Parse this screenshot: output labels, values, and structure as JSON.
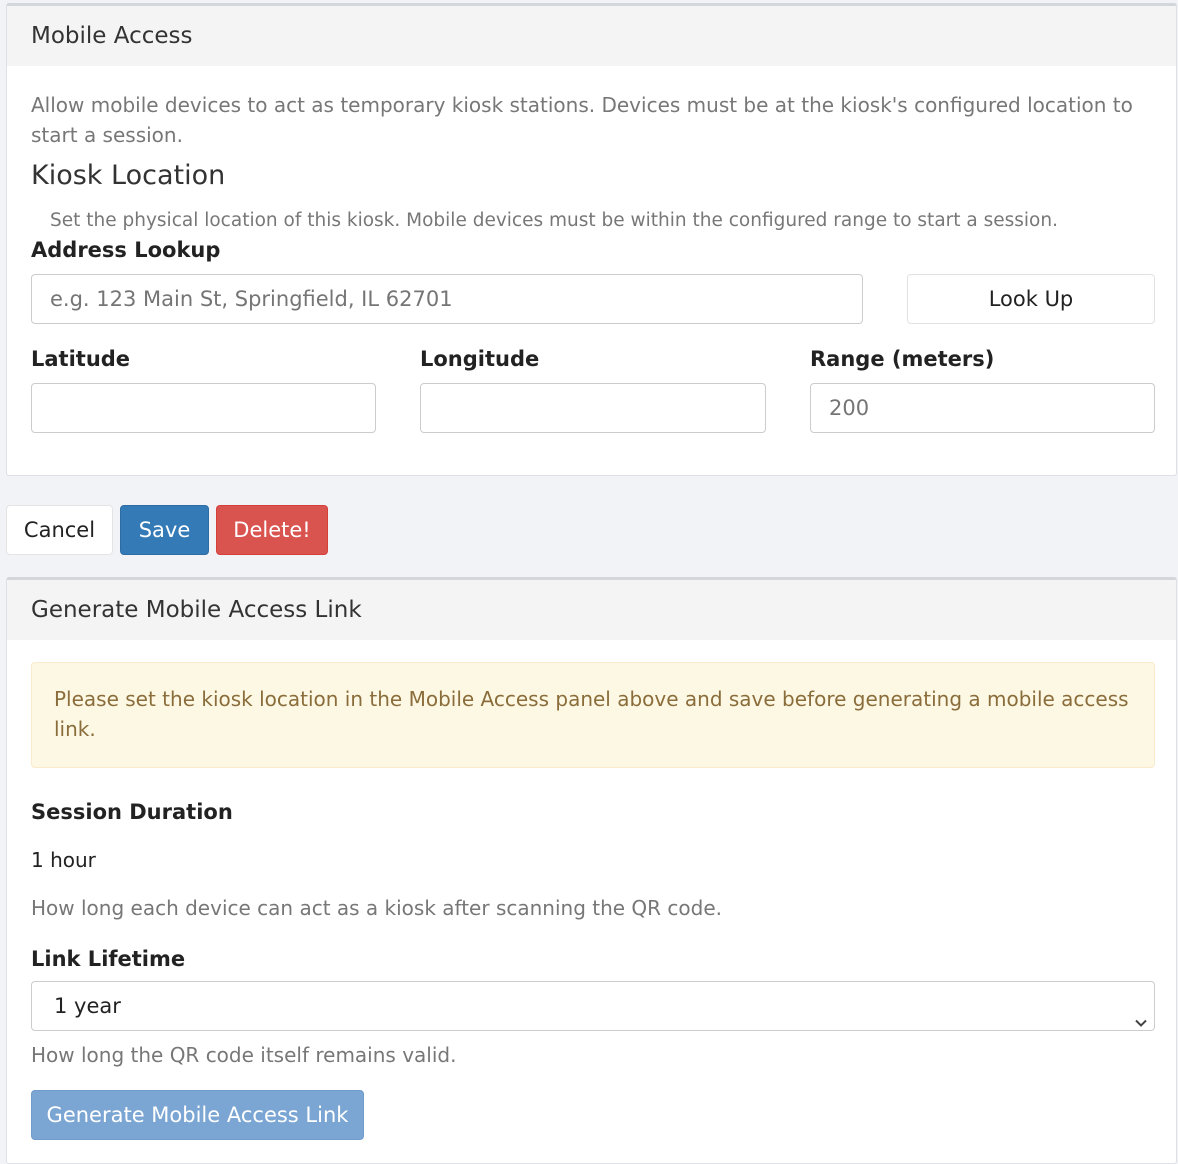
{
  "mobile_access": {
    "title": "Mobile Access",
    "description": "Allow mobile devices to act as temporary kiosk stations. Devices must be at the kiosk's configured location to start a session.",
    "kiosk_location_heading": "Kiosk Location",
    "kiosk_location_help": "Set the physical location of this kiosk. Mobile devices must be within the configured range to start a session.",
    "address_lookup_label": "Address Lookup",
    "address_placeholder": "e.g. 123 Main St, Springfield, IL 62701",
    "address_value": "",
    "lookup_button": "Look Up",
    "latitude_label": "Latitude",
    "latitude_value": "",
    "longitude_label": "Longitude",
    "longitude_value": "",
    "range_label": "Range (meters)",
    "range_placeholder": "200",
    "range_value": ""
  },
  "actions": {
    "cancel": "Cancel",
    "save": "Save",
    "delete": "Delete!"
  },
  "generate_link": {
    "title": "Generate Mobile Access Link",
    "warning": "Please set the kiosk location in the Mobile Access panel above and save before generating a mobile access link.",
    "session_duration_label": "Session Duration",
    "session_duration_value": "1 hour",
    "session_duration_help": "How long each device can act as a kiosk after scanning the QR code.",
    "link_lifetime_label": "Link Lifetime",
    "link_lifetime_selected": "1 year",
    "link_lifetime_help": "How long the QR code itself remains valid.",
    "generate_button": "Generate Mobile Access Link",
    "generate_button_disabled": true
  },
  "colors": {
    "save": "#337ab7",
    "delete": "#d9534f",
    "warning_bg": "#fcf8e3",
    "warning_text": "#8a6d3b",
    "generate_disabled": "#7ba6d3"
  }
}
